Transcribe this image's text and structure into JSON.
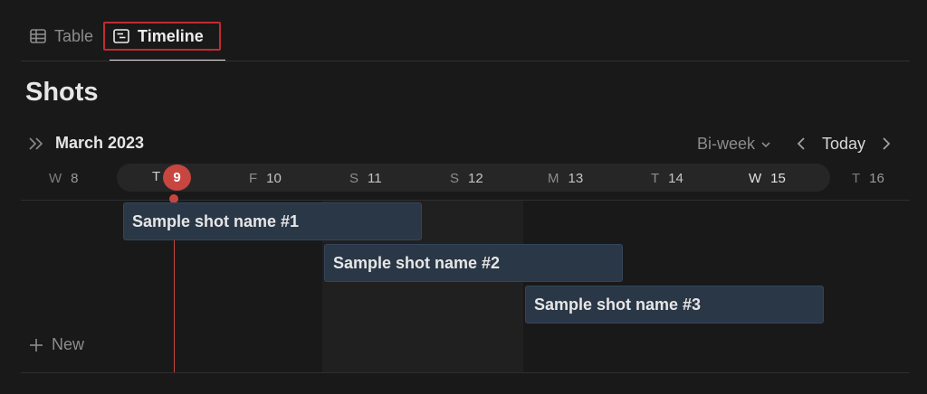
{
  "tabs": [
    {
      "label": "Table",
      "icon": "table-icon",
      "active": false
    },
    {
      "label": "Timeline",
      "icon": "timeline-icon",
      "active": true
    }
  ],
  "page": {
    "title": "Shots"
  },
  "header": {
    "month": "March 2023",
    "range": "Bi-week",
    "today_label": "Today"
  },
  "days": [
    {
      "letter": "W",
      "num": "8"
    },
    {
      "letter": "T",
      "num": "9"
    },
    {
      "letter": "F",
      "num": "10"
    },
    {
      "letter": "S",
      "num": "11"
    },
    {
      "letter": "S",
      "num": "12"
    },
    {
      "letter": "M",
      "num": "13"
    },
    {
      "letter": "T",
      "num": "14"
    },
    {
      "letter": "W",
      "num": "15"
    },
    {
      "letter": "T",
      "num": "16"
    }
  ],
  "items": [
    {
      "name": "Sample shot name #1"
    },
    {
      "name": "Sample shot name #2"
    },
    {
      "name": "Sample shot name #3"
    }
  ],
  "new_label": "New",
  "colors": {
    "background": "#191919",
    "today_accent": "#c74640",
    "bar_fill": "#2a3746",
    "tab_highlight": "#c22b30"
  }
}
